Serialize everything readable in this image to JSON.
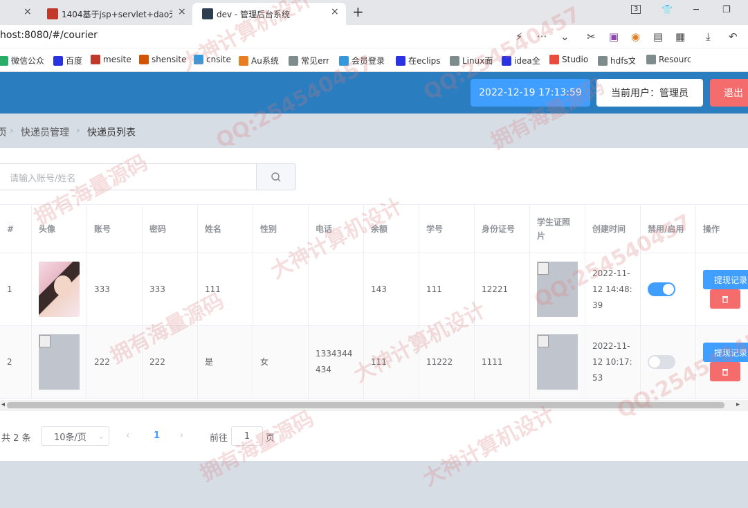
{
  "browser": {
    "tabs": [
      {
        "title": "1404基于jsp+servlet+dao无"
      },
      {
        "title": "dev - 管理后台系统"
      }
    ],
    "close_glyph": "×",
    "new_tab_glyph": "+",
    "tab_count": "3",
    "url": "host:8080/#/courier",
    "bookmarks": [
      {
        "label": "微信公众",
        "color": "#2aae67"
      },
      {
        "label": "百度",
        "color": "#2932e1"
      },
      {
        "label": "mesite",
        "color": "#c0392b"
      },
      {
        "label": "shensite",
        "color": "#d35400"
      },
      {
        "label": "cnsite",
        "color": "#3498db"
      },
      {
        "label": "Au系统",
        "color": "#e67e22"
      },
      {
        "label": "常见err",
        "color": "#7f8c8d"
      },
      {
        "label": "会员登录",
        "color": "#3498db"
      },
      {
        "label": "在eclips",
        "color": "#2932e1"
      },
      {
        "label": "Linux面",
        "color": "#7f8c8d"
      },
      {
        "label": "idea全",
        "color": "#2932e1"
      },
      {
        "label": "Studio",
        "color": "#e74c3c"
      },
      {
        "label": "hdfs文",
        "color": "#7f8c8d"
      },
      {
        "label": "Resourc",
        "color": "#7f8c8d"
      }
    ]
  },
  "header": {
    "datetime": "2022-12-19 17:13:59",
    "current_user": "当前用户：管理员",
    "logout_label": "退出"
  },
  "breadcrumb": {
    "home": "页",
    "section": "快递员管理",
    "page": "快递员列表",
    "separator": "›"
  },
  "search": {
    "placeholder": "请输入账号/姓名"
  },
  "table": {
    "columns": [
      "#",
      "头像",
      "账号",
      "密码",
      "姓名",
      "性别",
      "电话",
      "余额",
      "学号",
      "身份证号",
      "学生证照片",
      "创建时间",
      "禁用/启用",
      "操作"
    ],
    "rows": [
      {
        "index": "1",
        "account": "333",
        "password": "333",
        "name": "111",
        "gender": "",
        "phone": "",
        "balance": "143",
        "student_no": "111",
        "id_no": "12221",
        "created": "2022-11-12 14:48:39",
        "enabled": true
      },
      {
        "index": "2",
        "account": "222",
        "password": "222",
        "name": "是",
        "gender": "女",
        "phone": "1334344434",
        "balance": "111",
        "student_no": "11222",
        "id_no": "1111",
        "created": "2022-11-12 10:17:53",
        "enabled": false
      }
    ],
    "withdraw_label": "提现记录",
    "delete_icon": "trash-icon"
  },
  "pagination": {
    "total": "共 2 条",
    "page_size": "10条/页",
    "current_page": "1",
    "goto_prefix": "前往",
    "goto_value": "1",
    "goto_suffix": "页"
  },
  "watermark": {
    "texts": [
      "大神计算机设计",
      "拥有海量源码",
      "QQ:254540457"
    ]
  },
  "colors": {
    "header_bg": "#2a7ebf",
    "primary": "#409eff",
    "danger": "#f56c6c",
    "page_bg": "#d6dde5"
  }
}
